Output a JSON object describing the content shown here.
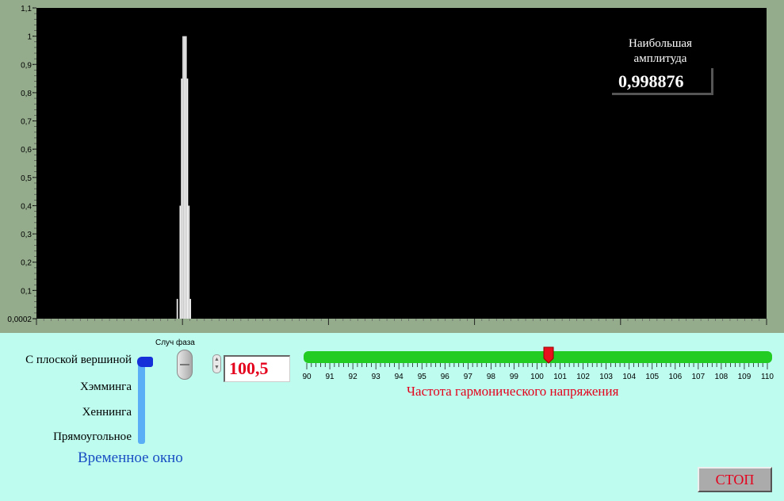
{
  "amplitude": {
    "title": "Наибольшая амплитуда",
    "value": "0,998876"
  },
  "window": {
    "title": "Временное окно",
    "options": [
      "С плоской вершиной",
      "Хэмминга",
      "Хеннинга",
      "Прямоугольное"
    ],
    "selected": "С плоской вершиной"
  },
  "phase": {
    "label": "Случ фаза",
    "state": "off"
  },
  "frequency": {
    "value": "100,5",
    "slider_title": "Частота гармонического напряжения",
    "min": 90,
    "max": 110,
    "slider_value": 100.5,
    "tick_labels": [
      "90",
      "91",
      "92",
      "93",
      "94",
      "95",
      "96",
      "97",
      "98",
      "99",
      "100",
      "101",
      "102",
      "103",
      "104",
      "105",
      "106",
      "107",
      "108",
      "109",
      "110"
    ]
  },
  "stop_button": {
    "label": "СТОП"
  },
  "colors": {
    "plot_bg": "#000000",
    "frame_bg": "#94ac8c",
    "panel_bg": "#bdfcee",
    "accent_red": "#e4001c",
    "slider_green": "#22cc22"
  },
  "chart_data": {
    "type": "bar",
    "y_tick_labels": [
      "1,1",
      "1",
      "0,9",
      "0,8",
      "0,7",
      "0,6",
      "0,5",
      "0,4",
      "0,3",
      "0,2",
      "0,1",
      "0,0002"
    ],
    "ylim": [
      0,
      1.1
    ],
    "xlim": [
      86,
      111
    ],
    "x": [
      90.8,
      90.9,
      90.95,
      91.0,
      91.05,
      91.1,
      91.15,
      91.2,
      91.25
    ],
    "values": [
      0.07,
      0.4,
      0.85,
      1.0,
      1.0,
      1.0,
      0.85,
      0.4,
      0.07
    ]
  }
}
